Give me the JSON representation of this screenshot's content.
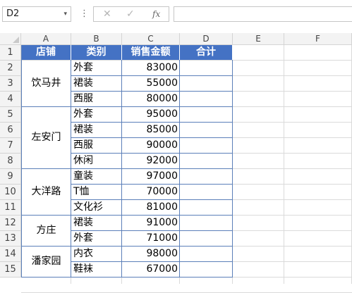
{
  "formula_bar": {
    "name_box": "D2",
    "dropdown_icon": "▾",
    "more_icon": "⋮",
    "cancel_icon": "✕",
    "confirm_icon": "✓",
    "function_icon": "fx",
    "formula": ""
  },
  "columns": [
    "A",
    "B",
    "C",
    "D",
    "E",
    "F"
  ],
  "rows": [
    "1",
    "2",
    "3",
    "4",
    "5",
    "6",
    "7",
    "8",
    "9",
    "10",
    "11",
    "12",
    "13",
    "14",
    "15"
  ],
  "table": {
    "headers": [
      "店铺",
      "类别",
      "销售金额",
      "合计"
    ],
    "groups": [
      {
        "store": "饮马井",
        "items": [
          {
            "category": "外套",
            "amount": "83000"
          },
          {
            "category": "裙装",
            "amount": "55000"
          },
          {
            "category": "西服",
            "amount": "80000"
          }
        ]
      },
      {
        "store": "左安门",
        "items": [
          {
            "category": "外套",
            "amount": "95000"
          },
          {
            "category": "裙装",
            "amount": "85000"
          },
          {
            "category": "西服",
            "amount": "90000"
          },
          {
            "category": "休闲",
            "amount": "92000"
          }
        ]
      },
      {
        "store": "大洋路",
        "items": [
          {
            "category": "童装",
            "amount": "97000"
          },
          {
            "category": "T恤",
            "amount": "70000"
          },
          {
            "category": "文化衫",
            "amount": "81000"
          }
        ]
      },
      {
        "store": "方庄",
        "items": [
          {
            "category": "裙装",
            "amount": "91000"
          },
          {
            "category": "外套",
            "amount": "71000"
          }
        ]
      },
      {
        "store": "潘家园",
        "items": [
          {
            "category": "内衣",
            "amount": "98000"
          },
          {
            "category": "鞋袜",
            "amount": "67000"
          }
        ]
      }
    ]
  },
  "colors": {
    "header_fill": "#4472c4",
    "header_text": "#ffffff",
    "table_border": "#5b7fb9",
    "gridline": "#dadada"
  }
}
